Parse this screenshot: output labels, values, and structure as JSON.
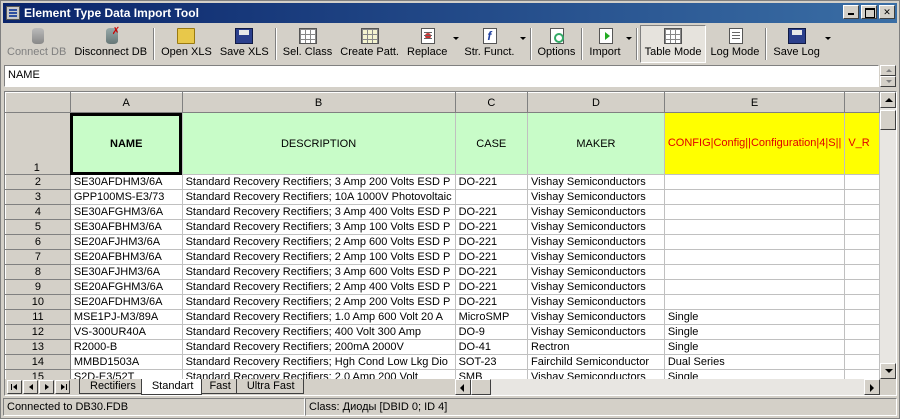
{
  "window": {
    "title": "Element Type Data Import Tool"
  },
  "toolbar": {
    "connect_db": "Connect DB",
    "disconnect_db": "Disconnect DB",
    "open_xls": "Open XLS",
    "save_xls": "Save XLS",
    "sel_class": "Sel. Class",
    "create_patt": "Create Patt.",
    "replace": "Replace",
    "str_funct": "Str. Funct.",
    "options": "Options",
    "import": "Import",
    "table_mode": "Table Mode",
    "log_mode": "Log Mode",
    "save_log": "Save Log"
  },
  "cell_editor": {
    "value": "NAME"
  },
  "sheet": {
    "columns": [
      "A",
      "B",
      "C",
      "D",
      "E"
    ],
    "header_row": {
      "row_number": "1",
      "name": "NAME",
      "description": "DESCRIPTION",
      "case": "CASE",
      "maker": "MAKER",
      "config": "CONFIG|Config||Configuration|4|S||",
      "v_r": "V_R"
    },
    "rows": [
      {
        "n": "2",
        "name": "SE30AFDHM3/6A",
        "description": "Standard Recovery Rectifiers; 3 Amp 200 Volts ESD P",
        "case": "DO-221",
        "maker": "Vishay Semiconductors",
        "config": ""
      },
      {
        "n": "3",
        "name": "GPP100MS-E3/73",
        "description": "Standard Recovery Rectifiers; 10A 1000V Photovoltaic",
        "case": "",
        "maker": "Vishay Semiconductors",
        "config": ""
      },
      {
        "n": "4",
        "name": "SE30AFGHM3/6A",
        "description": "Standard Recovery Rectifiers; 3 Amp 400 Volts ESD P",
        "case": "DO-221",
        "maker": "Vishay Semiconductors",
        "config": ""
      },
      {
        "n": "5",
        "name": "SE30AFBHM3/6A",
        "description": "Standard Recovery Rectifiers; 3 Amp 100 Volts ESD P",
        "case": "DO-221",
        "maker": "Vishay Semiconductors",
        "config": ""
      },
      {
        "n": "6",
        "name": "SE20AFJHM3/6A",
        "description": "Standard Recovery Rectifiers; 2 Amp 600 Volts ESD P",
        "case": "DO-221",
        "maker": "Vishay Semiconductors",
        "config": ""
      },
      {
        "n": "7",
        "name": "SE20AFBHM3/6A",
        "description": "Standard Recovery Rectifiers; 2 Amp 100 Volts ESD P",
        "case": "DO-221",
        "maker": "Vishay Semiconductors",
        "config": ""
      },
      {
        "n": "8",
        "name": "SE30AFJHM3/6A",
        "description": "Standard Recovery Rectifiers; 3 Amp 600 Volts ESD P",
        "case": "DO-221",
        "maker": "Vishay Semiconductors",
        "config": ""
      },
      {
        "n": "9",
        "name": "SE20AFGHM3/6A",
        "description": "Standard Recovery Rectifiers; 2 Amp 400 Volts ESD P",
        "case": "DO-221",
        "maker": "Vishay Semiconductors",
        "config": ""
      },
      {
        "n": "10",
        "name": "SE20AFDHM3/6A",
        "description": "Standard Recovery Rectifiers; 2 Amp 200 Volts ESD P",
        "case": "DO-221",
        "maker": "Vishay Semiconductors",
        "config": ""
      },
      {
        "n": "11",
        "name": "MSE1PJ-M3/89A",
        "description": "Standard Recovery Rectifiers; 1.0 Amp 600 Volt 20 A",
        "case": "MicroSMP",
        "maker": "Vishay Semiconductors",
        "config": "Single"
      },
      {
        "n": "12",
        "name": "VS-300UR40A",
        "description": "Standard Recovery Rectifiers; 400 Volt 300 Amp",
        "case": "DO-9",
        "maker": "Vishay Semiconductors",
        "config": "Single"
      },
      {
        "n": "13",
        "name": "R2000-B",
        "description": "Standard Recovery Rectifiers; 200mA 2000V",
        "case": "DO-41",
        "maker": "Rectron",
        "config": "Single"
      },
      {
        "n": "14",
        "name": "MMBD1503A",
        "description": "Standard Recovery Rectifiers; Hgh Cond Low Lkg Dio",
        "case": "SOT-23",
        "maker": "Fairchild Semiconductor",
        "config": "Dual Series"
      },
      {
        "n": "15",
        "name": "S2D-E3/52T",
        "description": "Standard Recovery Rectifiers; 2.0 Amp 200 Volt",
        "case": "SMB",
        "maker": "Vishay Semiconductors",
        "config": "Single"
      }
    ]
  },
  "tabs": [
    {
      "label": "Rectifiers",
      "active": false
    },
    {
      "label": "Standart",
      "active": true
    },
    {
      "label": "Fast",
      "active": false
    },
    {
      "label": "Ultra Fast",
      "active": false
    }
  ],
  "status": {
    "connection": "Connected to DB30.FDB",
    "class": "Class: Диоды [DBID 0; ID 4]"
  },
  "colors": {
    "header_green": "#c8fcc8",
    "header_yellow": "#ffff00",
    "config_text_red": "#e00000",
    "title_bar": "#0a246a"
  }
}
